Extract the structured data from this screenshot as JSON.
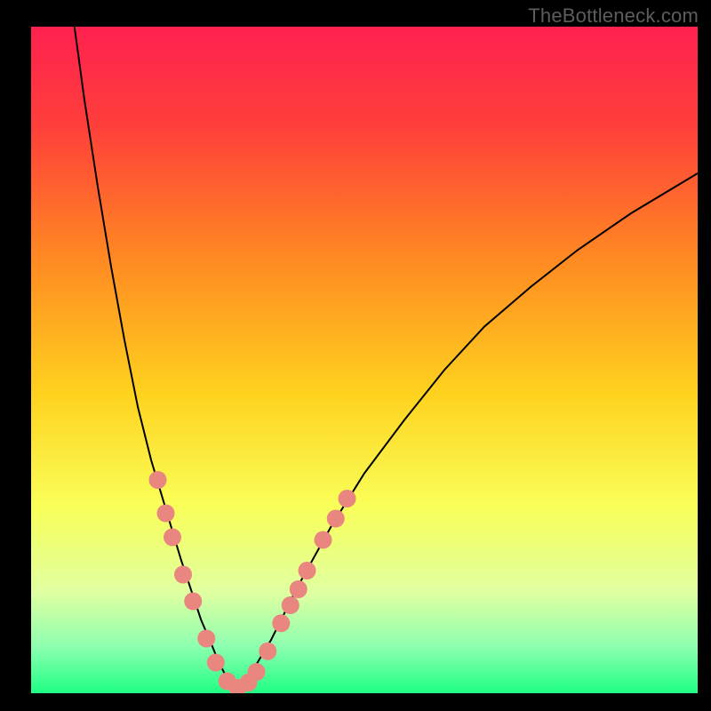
{
  "watermark": "TheBottleneck.com",
  "chart_data": {
    "type": "line",
    "title": "",
    "xlabel": "",
    "ylabel": "",
    "xlim": [
      0,
      100
    ],
    "ylim": [
      0,
      100
    ],
    "grid": false,
    "legend": false,
    "gradient_stops": [
      {
        "offset": 0.0,
        "color": "#ff2150"
      },
      {
        "offset": 0.15,
        "color": "#ff3f3a"
      },
      {
        "offset": 0.35,
        "color": "#ff8a22"
      },
      {
        "offset": 0.55,
        "color": "#ffd21e"
      },
      {
        "offset": 0.72,
        "color": "#f9ff59"
      },
      {
        "offset": 0.85,
        "color": "#dfffa1"
      },
      {
        "offset": 0.93,
        "color": "#8dffb0"
      },
      {
        "offset": 1.0,
        "color": "#1fff84"
      }
    ],
    "series": [
      {
        "name": "left-branch",
        "color": "#000000",
        "width": 2,
        "x": [
          6.5,
          8,
          10,
          12,
          14,
          16,
          18,
          19.5,
          21,
          22.5,
          24,
          25.5,
          27,
          28,
          29,
          30,
          31
        ],
        "y": [
          100,
          89,
          76,
          64,
          53,
          43,
          35,
          30,
          25,
          20,
          15.5,
          11,
          7.5,
          5,
          3,
          1.5,
          0.5
        ]
      },
      {
        "name": "right-branch",
        "color": "#000000",
        "width": 2,
        "x": [
          31,
          33,
          36,
          40,
          45,
          50,
          56,
          62,
          68,
          75,
          82,
          90,
          100
        ],
        "y": [
          0.5,
          3,
          8,
          16,
          25,
          33,
          41,
          48.5,
          55,
          61,
          66.5,
          72,
          78
        ]
      }
    ],
    "markers": {
      "name": "coral-dots",
      "color": "#e8867f",
      "radius": 10,
      "points_xy": [
        [
          19.0,
          32.0
        ],
        [
          20.2,
          27.0
        ],
        [
          21.2,
          23.4
        ],
        [
          22.8,
          17.8
        ],
        [
          24.3,
          13.8
        ],
        [
          26.3,
          8.2
        ],
        [
          27.7,
          4.6
        ],
        [
          29.4,
          1.8
        ],
        [
          31.0,
          0.8
        ],
        [
          32.6,
          1.6
        ],
        [
          33.8,
          3.2
        ],
        [
          35.5,
          6.3
        ],
        [
          37.5,
          10.5
        ],
        [
          38.9,
          13.2
        ],
        [
          40.1,
          15.6
        ],
        [
          41.4,
          18.4
        ],
        [
          43.8,
          23.0
        ],
        [
          45.7,
          26.2
        ],
        [
          47.4,
          29.2
        ]
      ]
    }
  }
}
